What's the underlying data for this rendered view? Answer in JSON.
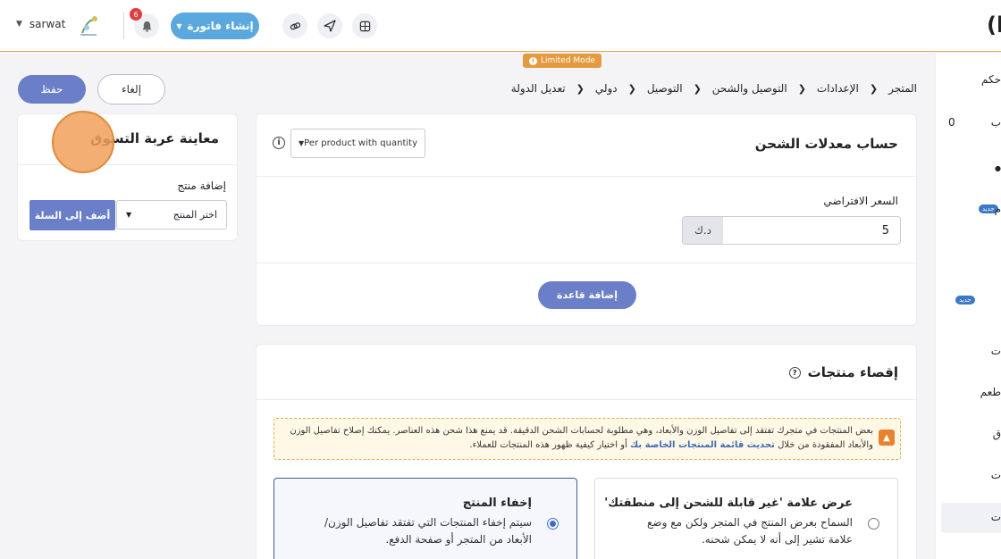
{
  "header": {
    "user_name": "sarwat",
    "notification_count": "6",
    "create_invoice_label": "إنشاء فاتورة",
    "limited_mode_label": "Limited Mode",
    "brand_glyph": "(l"
  },
  "sidebar": {
    "items": [
      {
        "label": "حكم"
      },
      {
        "label": "ب"
      },
      {
        "label": "م"
      },
      {
        "label": "ت"
      },
      {
        "label": "طعم"
      },
      {
        "label": "ق"
      },
      {
        "label": "ت"
      },
      {
        "label": "ت"
      }
    ],
    "zero_value": "0",
    "new_badge_1": "جديد",
    "new_badge_2": "جديد"
  },
  "actions": {
    "save_label": "حفظ",
    "cancel_label": "إلغاء"
  },
  "breadcrumb": [
    "المتجر",
    "الإعدادات",
    "التوصيل والشحن",
    "التوصيل",
    "دولي",
    "تعديل الدولة"
  ],
  "cart_preview": {
    "title": "معاينة عربة التسوق",
    "add_product_label": "إضافة منتج",
    "select_placeholder": "اختر المنتج",
    "add_to_cart_label": "أضف إلى السلة"
  },
  "shipping_rates": {
    "title": "حساب معدلات الشحن",
    "method_value": "Per product with quantity",
    "default_price_label": "السعر الافتراضي",
    "default_price_value": "5",
    "currency": "د.ك",
    "add_rule_label": "إضافة قاعدة"
  },
  "exclude_products": {
    "title": "إقصاء منتجات",
    "warning_text": "بعض المنتجات في متجرك تفتقد إلى تفاصيل الوزن والأبعاد، وهي مطلوبة لحسابات الشحن الدقيقة. قد يمنع هذا شحن هذه العناصر. يمكنك إصلاح تفاصيل الوزن والأبعاد المفقودة من خلال",
    "warning_link": "تحديث قائمة المنتجات الخاصة بك",
    "warning_tail": "أو اختيار كيفية ظهور هذه المنتجات للعملاء.",
    "option_show": {
      "title": "عرض علامة 'غير قابلة للشحن إلى منطقتك'",
      "desc": "السماح بعرض المنتج في المتجر ولكن مع وضع علامة تشير إلى أنه لا يمكن شحنه."
    },
    "option_hide": {
      "title": "إخفاء المنتج",
      "desc": "سيتم إخفاء المنتجات التي تفتقد تفاصيل الوزن/الأبعاد من المتجر أو صفحة الدفع."
    }
  }
}
